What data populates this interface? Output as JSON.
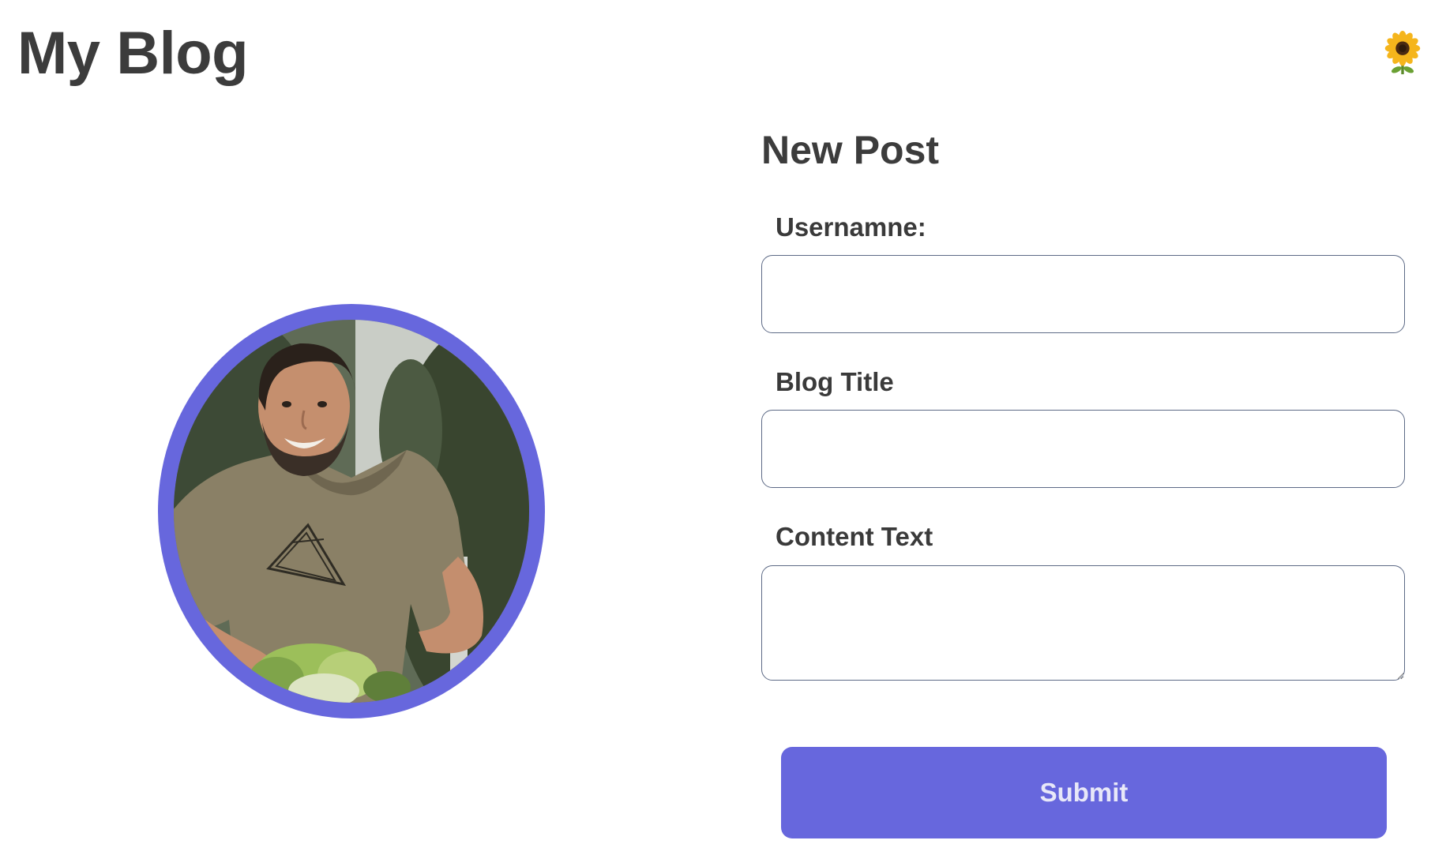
{
  "header": {
    "title": "My Blog",
    "theme_icon": "sunflower-icon"
  },
  "profile": {
    "image": "avatar-photo"
  },
  "form": {
    "title": "New Post",
    "username": {
      "label": "Usernamne:",
      "value": "",
      "placeholder": ""
    },
    "blog_title": {
      "label": "Blog Title",
      "value": "",
      "placeholder": ""
    },
    "content": {
      "label": "Content Text",
      "value": "",
      "placeholder": ""
    },
    "submit_label": "Submit"
  },
  "colors": {
    "accent": "#6767dd",
    "text": "#3a3a3a",
    "input_border": "#5d6a86",
    "background": "#ffffff"
  }
}
